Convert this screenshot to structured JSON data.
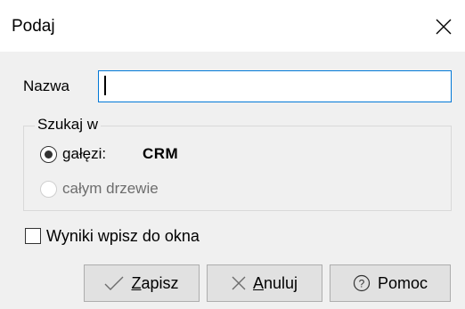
{
  "window": {
    "title": "Podaj",
    "close_icon": "close-icon"
  },
  "form": {
    "name_label": "Nazwa",
    "name_value": "",
    "search_group": {
      "legend": "Szukaj w",
      "option_branch_label": "gałęzi:",
      "option_branch_value": "CRM",
      "option_branch_checked": true,
      "option_tree_label": "całym drzewie",
      "option_tree_checked": false,
      "option_tree_enabled": false
    },
    "results_checkbox_label": "Wyniki wpisz do okna",
    "results_checkbox_checked": false
  },
  "buttons": {
    "save": {
      "mnemonic": "Z",
      "rest": "apisz",
      "icon": "checkmark-icon"
    },
    "cancel": {
      "mnemonic": "A",
      "rest": "nuluj",
      "icon": "close-icon"
    },
    "help": {
      "label": "Pomoc",
      "icon": "question-circle-icon"
    }
  },
  "colors": {
    "focus_border": "#0078d7",
    "button_bg": "#e1e1e1",
    "dialog_bg": "#f0f0f0"
  }
}
